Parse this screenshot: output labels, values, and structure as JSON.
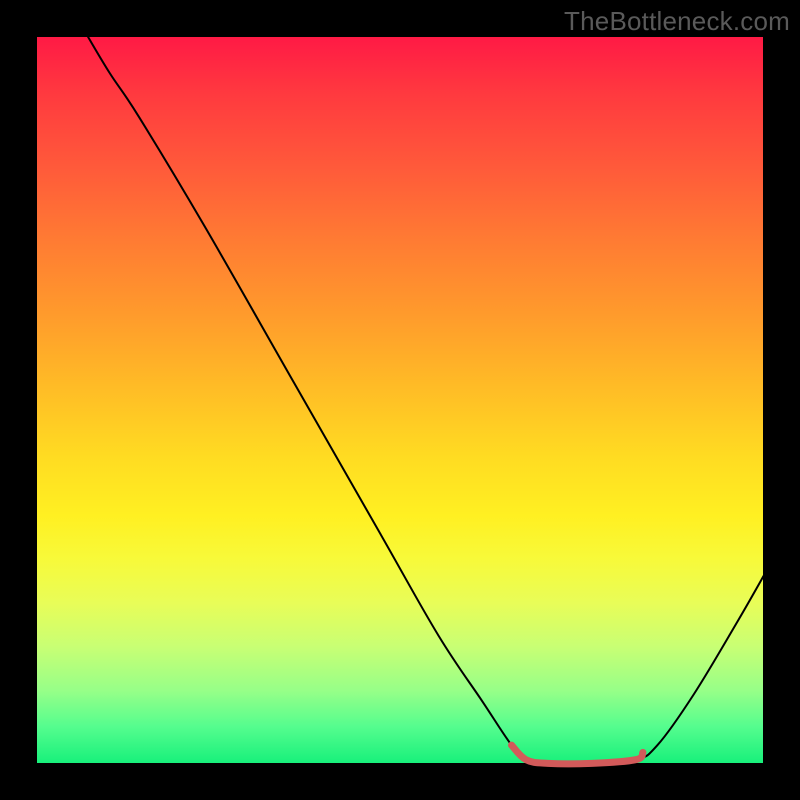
{
  "watermark": "TheBottleneck.com",
  "chart_data": {
    "type": "line",
    "title": "",
    "xlabel": "",
    "ylabel": "",
    "xlim": [
      0,
      100
    ],
    "ylim": [
      0,
      100
    ],
    "grid": false,
    "series": [
      {
        "name": "curve",
        "color": "#000000",
        "width": 2,
        "points": [
          {
            "x": 7,
            "y": 100
          },
          {
            "x": 10,
            "y": 95
          },
          {
            "x": 14,
            "y": 89
          },
          {
            "x": 23,
            "y": 74
          },
          {
            "x": 35,
            "y": 53
          },
          {
            "x": 47,
            "y": 32
          },
          {
            "x": 55,
            "y": 18
          },
          {
            "x": 61,
            "y": 9
          },
          {
            "x": 65,
            "y": 3
          },
          {
            "x": 67,
            "y": 1
          },
          {
            "x": 70,
            "y": 0.5
          },
          {
            "x": 76,
            "y": 0.5
          },
          {
            "x": 82,
            "y": 1
          },
          {
            "x": 85,
            "y": 3
          },
          {
            "x": 90,
            "y": 10
          },
          {
            "x": 96,
            "y": 20
          },
          {
            "x": 100,
            "y": 27
          }
        ]
      },
      {
        "name": "flat-marker",
        "color": "#d25a5a",
        "width": 7,
        "points": [
          {
            "x": 65,
            "y": 3
          },
          {
            "x": 67,
            "y": 1
          },
          {
            "x": 70,
            "y": 0.5
          },
          {
            "x": 76,
            "y": 0.5
          },
          {
            "x": 82,
            "y": 1
          },
          {
            "x": 83,
            "y": 2
          }
        ]
      }
    ]
  }
}
